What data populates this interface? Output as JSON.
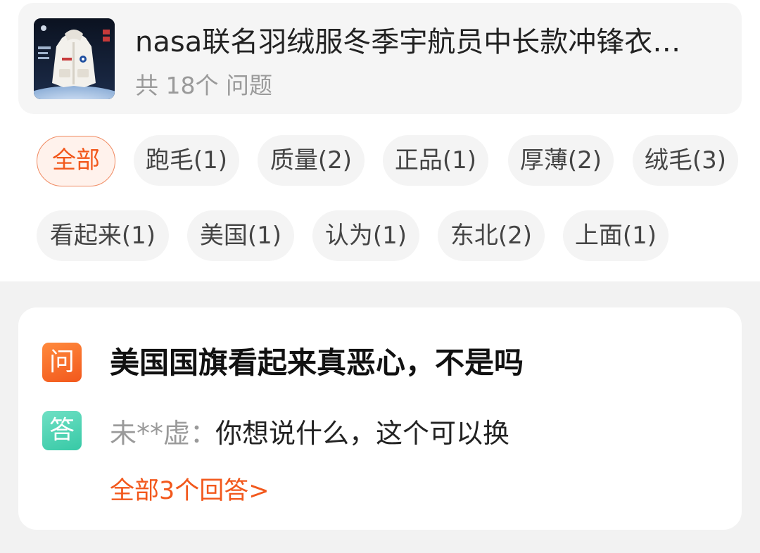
{
  "product": {
    "title": "nasa联名羽绒服冬季宇航员中长款冲锋衣…",
    "question_count": "共 18个 问题"
  },
  "tags": [
    {
      "label": "全部",
      "active": true
    },
    {
      "label": "跑毛(1)"
    },
    {
      "label": "质量(2)"
    },
    {
      "label": "正品(1)"
    },
    {
      "label": "厚薄(2)"
    },
    {
      "label": "绒毛(3)"
    },
    {
      "label": "看起来(1)"
    },
    {
      "label": "美国(1)"
    },
    {
      "label": "认为(1)"
    },
    {
      "label": "东北(2)"
    },
    {
      "label": "上面(1)"
    }
  ],
  "qa": {
    "question_badge": "问",
    "question": "美国国旗看起来真恶心，不是吗",
    "answer_badge": "答",
    "answer_user": "未**虚：",
    "answer_text": "你想说什么，这个可以换",
    "all_answers": "全部3个回答>"
  },
  "colors": {
    "accent": "#f2581c",
    "answer_badge": "#37c9a6",
    "chip_bg": "#f4f4f4",
    "section_bg": "#f2f2f2"
  }
}
